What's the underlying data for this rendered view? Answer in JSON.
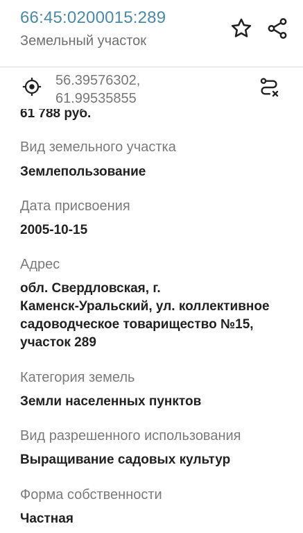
{
  "header": {
    "cadastral_number": "66:45:0200015:289",
    "object_type": "Земельный участок",
    "favorite_icon": "star-outline-icon",
    "share_icon": "share-icon"
  },
  "coordinates": {
    "locate_icon": "crosshair-location-icon",
    "latitude": "56.39576302,",
    "longitude": "61.99535855",
    "route_icon": "route-clear-icon"
  },
  "details": {
    "cost_value": "61 788 руб.",
    "land_type_label": "Вид земельного участка",
    "land_type_value": "Землепользование",
    "assignment_date_label": "Дата присвоения",
    "assignment_date_value": "2005-10-15",
    "address_label": "Адрес",
    "address_line1": "обл. Свердловская, г.",
    "address_line2": "Каменск-Уральский, ул. коллективное",
    "address_line3": "садоводческое товарищество №15,",
    "address_line4": "участок 289",
    "land_category_label": "Категория земель",
    "land_category_value": "Земли населенных пунктов",
    "permitted_use_label": "Вид разрешенного использования",
    "permitted_use_value": "Выращивание садовых культур",
    "ownership_label": "Форма собственности",
    "ownership_value": "Частная"
  }
}
